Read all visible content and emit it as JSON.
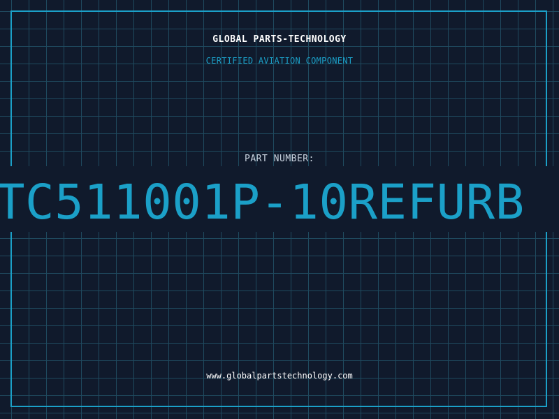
{
  "header": {
    "company": "GLOBAL PARTS-TECHNOLOGY",
    "tagline": "CERTIFIED AVIATION COMPONENT"
  },
  "part": {
    "label": "PART NUMBER:",
    "number": "TC511001P-10REFURB"
  },
  "footer": {
    "website": "www.globalpartstechnology.com"
  },
  "colors": {
    "background": "#101a2c",
    "grid": "#1f4a5f",
    "accent": "#1ba0c8",
    "text": "#ffffff"
  }
}
